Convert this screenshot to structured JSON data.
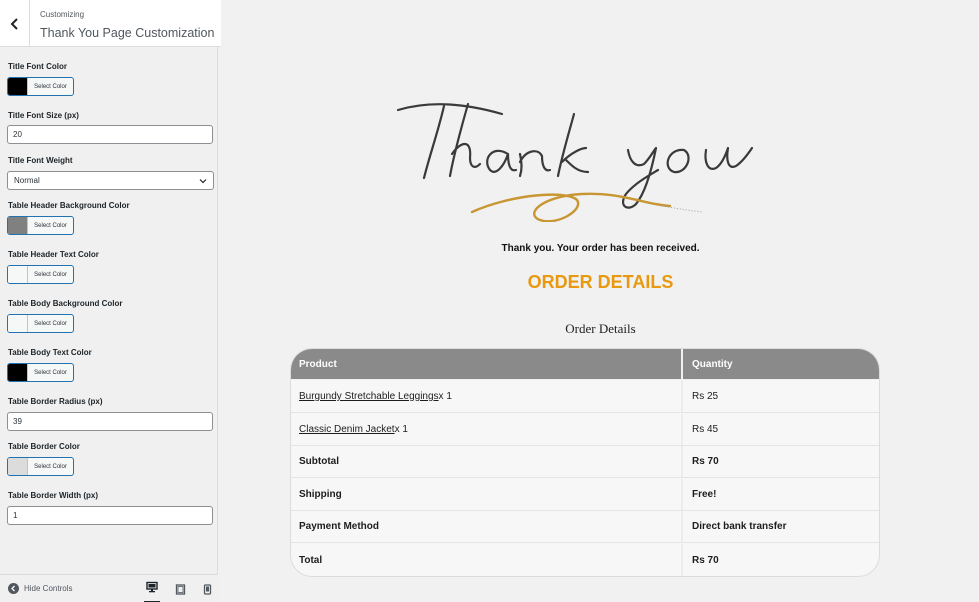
{
  "sidebar": {
    "subtitle": "Customizing",
    "title": "Thank You Page Customization",
    "controls": {
      "title_font_color": {
        "label": "Title Font Color",
        "button": "Select Color",
        "color": "#000000"
      },
      "title_font_size": {
        "label": "Title Font Size (px)",
        "value": "20"
      },
      "title_font_weight": {
        "label": "Title Font Weight",
        "value": "Normal"
      },
      "table_header_bg": {
        "label": "Table Header Background Color",
        "button": "Select Color",
        "color": "#808080"
      },
      "table_header_text": {
        "label": "Table Header Text Color",
        "button": "Select Color",
        "color": "#f6f7f7"
      },
      "table_body_bg": {
        "label": "Table Body Background Color",
        "button": "Select Color",
        "color": "#f6f7f7"
      },
      "table_body_text": {
        "label": "Table Body Text Color",
        "button": "Select Color",
        "color": "#000000"
      },
      "table_border_radius": {
        "label": "Table Border Radius (px)",
        "value": "39"
      },
      "table_border_color": {
        "label": "Table Border Color",
        "button": "Select Color",
        "color": "#dcdcdc"
      },
      "table_border_width": {
        "label": "Table Border Width (px)",
        "value": "1"
      }
    },
    "footer": {
      "hide_controls": "Hide Controls"
    }
  },
  "preview": {
    "received": "Thank you. Your order has been received.",
    "heading": "ORDER DETAILS",
    "subtitle": "Order Details",
    "accent_color": "#e8990f",
    "table": {
      "headers": [
        "Product",
        "Quantity"
      ],
      "items": [
        {
          "name": "Burgundy Stretchable Leggings",
          "qty": " x 1",
          "price": "Rs 25"
        },
        {
          "name": "Classic Denim Jacket",
          "qty": " x 1",
          "price": "Rs 45"
        }
      ],
      "summary": [
        {
          "label": "Subtotal",
          "value": "Rs 70"
        },
        {
          "label": "Shipping",
          "value": "Free!"
        },
        {
          "label": "Payment Method",
          "value": "Direct bank transfer"
        },
        {
          "label": "Total",
          "value": "Rs 70"
        }
      ]
    }
  }
}
